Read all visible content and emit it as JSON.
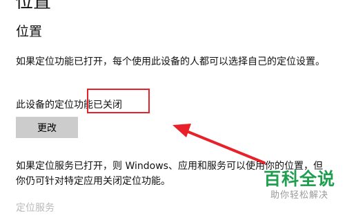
{
  "page": {
    "heading": "位置"
  },
  "location": {
    "title": "位置",
    "description": "如果定位功能已打开，每个使用此设备的人都可以选择自己的定位设置。",
    "status": "此设备的定位功能已关闭",
    "change_button": "更改"
  },
  "service": {
    "description": "如果定位服务已打开，则 Windows、应用和服务可以使用你的位置，但你仍可针对特定应用关闭定位功能。",
    "next_heading": "定位服务"
  },
  "annotation": {
    "color": "#e8202a"
  },
  "watermark": {
    "title": "百科全说",
    "subtitle": "助你轻松解决",
    "color": "#1e9e4e"
  }
}
